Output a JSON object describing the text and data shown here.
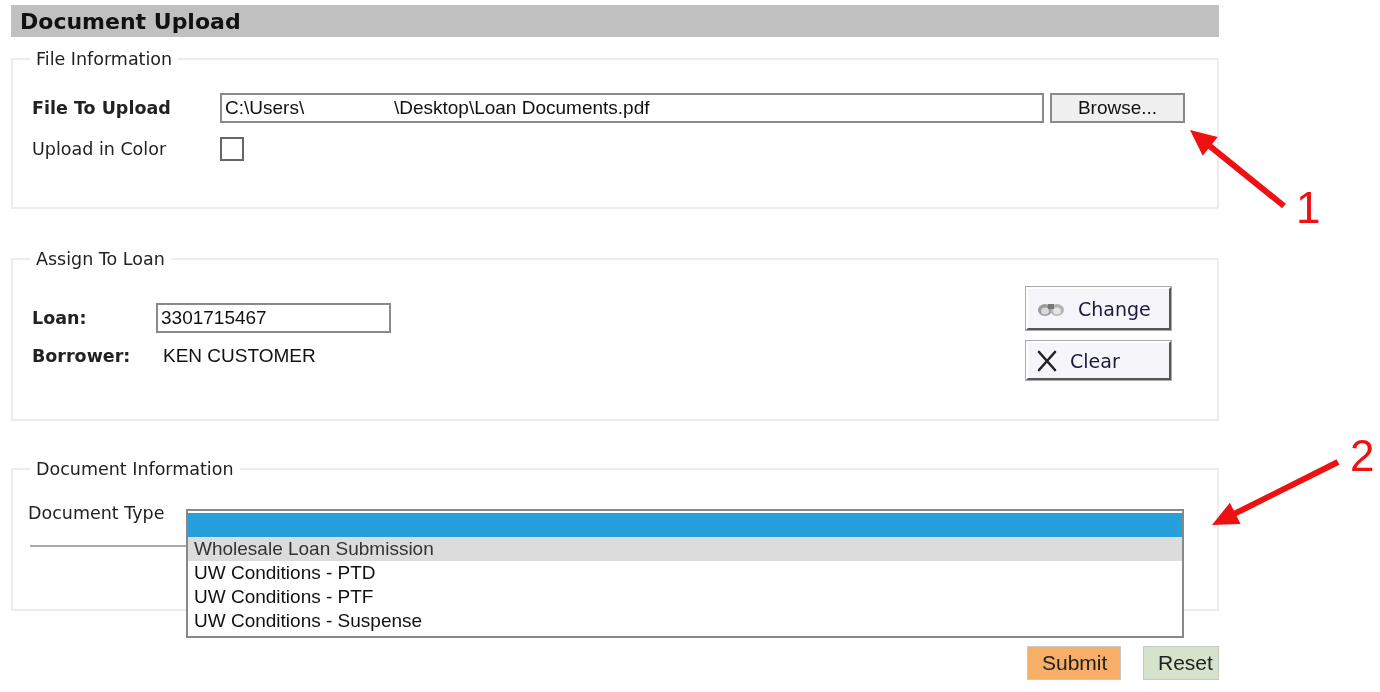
{
  "header": {
    "title": "Document Upload"
  },
  "file_information": {
    "legend": "File Information",
    "file_label": "File To Upload",
    "file_value": "C:\\Users\\                 \\Desktop\\Loan Documents.pdf",
    "browse_button": "Browse...",
    "color_label": "Upload in Color",
    "color_checked": false
  },
  "assign_to_loan": {
    "legend": "Assign To Loan",
    "loan_label": "Loan:",
    "loan_value": "3301715467",
    "borrower_label": "Borrower:",
    "borrower_value": "KEN CUSTOMER",
    "buttons": [
      {
        "kind": "binoculars",
        "label": "Change"
      },
      {
        "kind": "clear",
        "label": "Clear"
      }
    ]
  },
  "document_information": {
    "legend": "Document Information",
    "type_label": "Document Type",
    "blank_option_selected": true,
    "options": [
      {
        "label": "Wholesale Loan Submission",
        "hovered": true
      },
      {
        "label": "UW Conditions - PTD",
        "hovered": false
      },
      {
        "label": "UW Conditions - PTF",
        "hovered": false
      },
      {
        "label": "UW Conditions - Suspense",
        "hovered": false
      }
    ]
  },
  "actions": [
    {
      "kind": "submit",
      "label": "Submit"
    },
    {
      "kind": "reset",
      "label": "Reset"
    }
  ],
  "callouts": [
    {
      "number": "1"
    },
    {
      "number": "2"
    }
  ]
}
